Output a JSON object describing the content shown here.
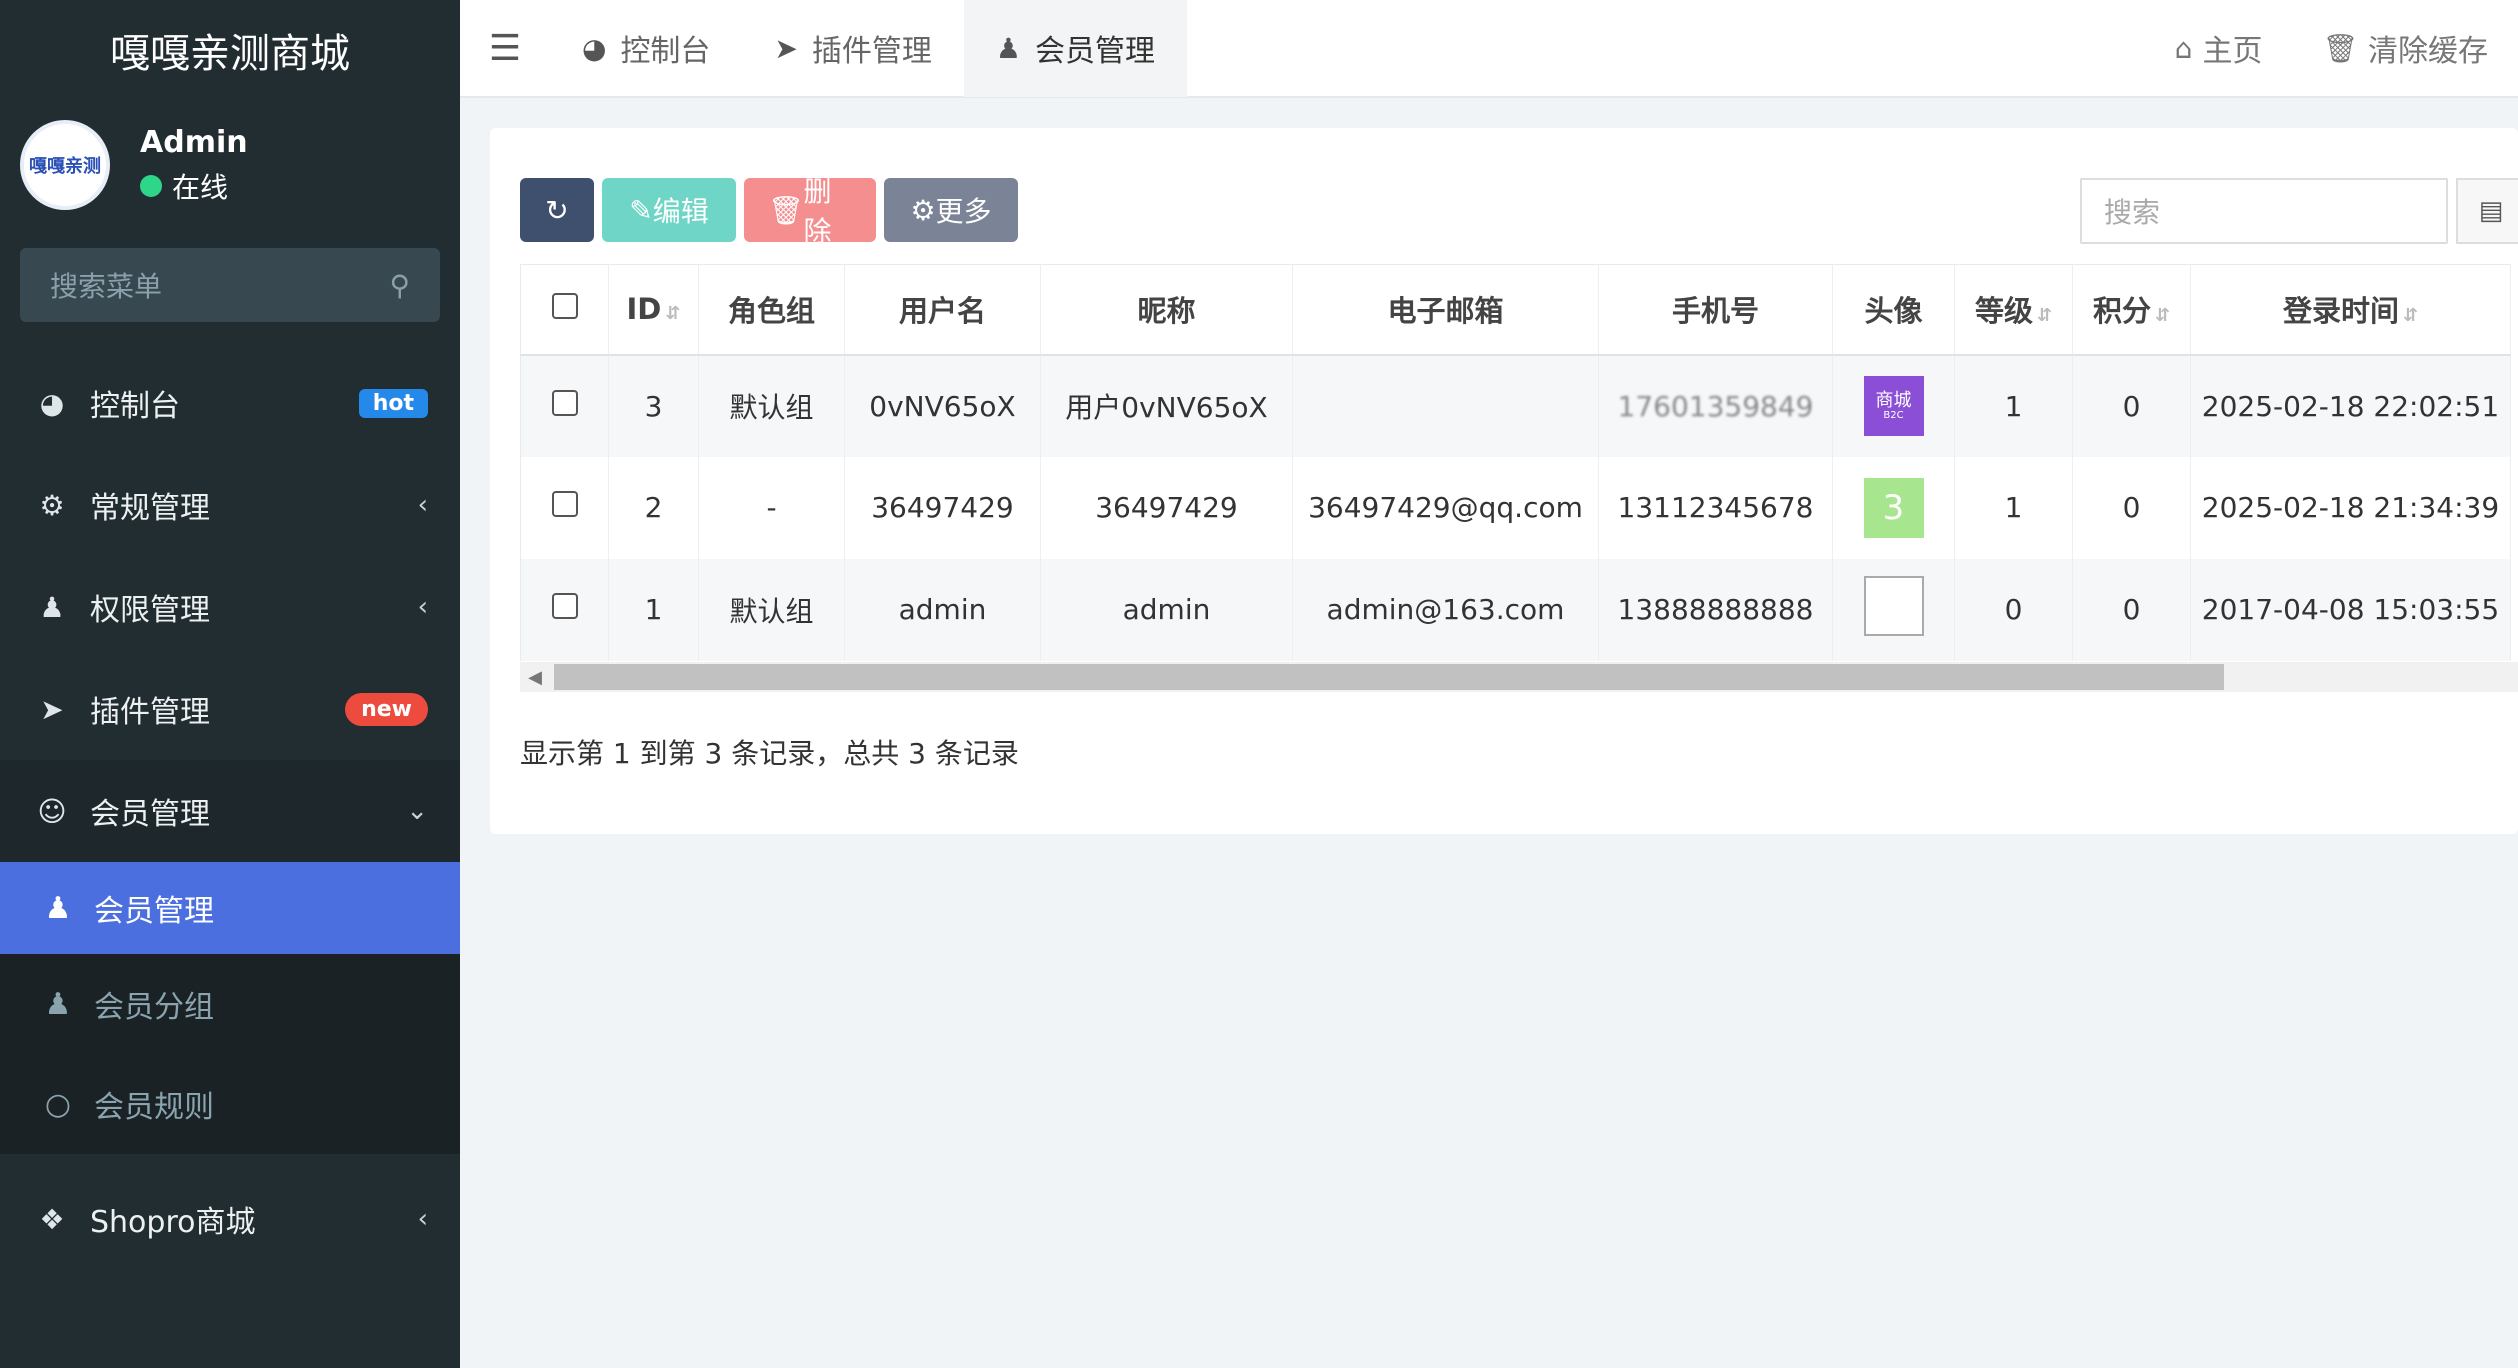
{
  "sidebar": {
    "brand": "嘎嘎亲测商城",
    "avatar_text": "嘎嘎亲测",
    "user_name": "Admin",
    "user_status": "在线",
    "search_placeholder": "搜索菜单",
    "items": [
      {
        "label": "控制台",
        "icon": "dashboard-icon",
        "badge": "hot"
      },
      {
        "label": "常规管理",
        "icon": "cogs-icon"
      },
      {
        "label": "权限管理",
        "icon": "group-icon"
      },
      {
        "label": "插件管理",
        "icon": "rocket-icon",
        "badge": "new"
      },
      {
        "label": "会员管理",
        "icon": "user-circle-icon"
      }
    ],
    "sub_items": [
      {
        "label": "会员管理",
        "icon": "user-icon"
      },
      {
        "label": "会员分组",
        "icon": "users-icon"
      },
      {
        "label": "会员规则",
        "icon": "circle-icon"
      }
    ],
    "shopro": {
      "label": "Shopro商城",
      "icon": "dropbox-icon"
    }
  },
  "topbar": {
    "tabs": [
      {
        "label": "控制台",
        "icon": "dashboard-icon"
      },
      {
        "label": "插件管理",
        "icon": "rocket-icon"
      },
      {
        "label": "会员管理",
        "icon": "user-icon"
      }
    ],
    "home_label": "主页",
    "clear_cache_label": "清除缓存"
  },
  "toolbar": {
    "edit_label": "编辑",
    "delete_label": "删除",
    "more_label": "更多",
    "search_placeholder": "搜索"
  },
  "table": {
    "headers": [
      "ID",
      "角色组",
      "用户名",
      "昵称",
      "电子邮箱",
      "手机号",
      "头像",
      "等级",
      "积分",
      "登录时间"
    ],
    "rows": [
      {
        "id": "3",
        "group": "默认组",
        "username": "0vNV65oX",
        "nickname": "用户0vNV65oX",
        "email": "",
        "mobile": "17601359849",
        "avatar": "商城",
        "avatar_sub": "B2C",
        "level": "1",
        "score": "0",
        "logintime": "2025-02-18 22:02:51"
      },
      {
        "id": "2",
        "group": "-",
        "username": "36497429",
        "nickname": "36497429",
        "email": "36497429@qq.com",
        "mobile": "13112345678",
        "avatar": "3",
        "level": "1",
        "score": "0",
        "logintime": "2025-02-18 21:34:39"
      },
      {
        "id": "1",
        "group": "默认组",
        "username": "admin",
        "nickname": "admin",
        "email": "admin@163.com",
        "mobile": "13888888888",
        "avatar": "",
        "level": "0",
        "score": "0",
        "logintime": "2017-04-08 15:03:55"
      }
    ]
  },
  "footer": {
    "record_info": "显示第 1 到第 3 条记录，总共 3 条记录"
  },
  "colors": {
    "sidebar_bg": "#222d32",
    "active_blue": "#4c6fe0",
    "hot_badge": "#2589e9",
    "new_badge": "#ee4b3f"
  }
}
